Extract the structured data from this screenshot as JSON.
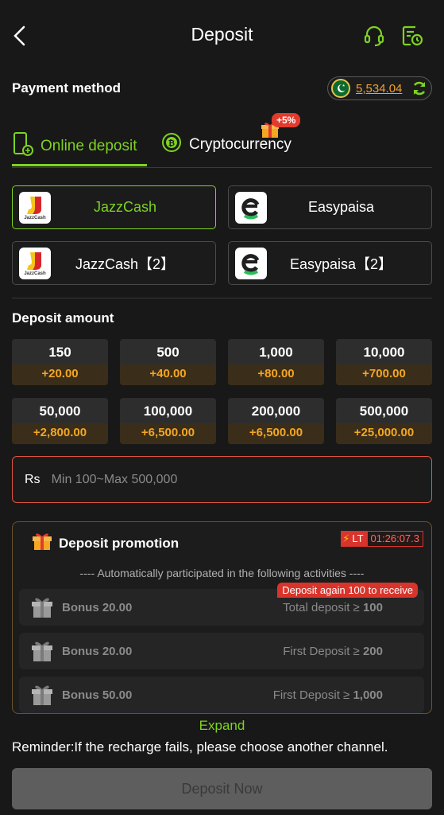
{
  "header": {
    "title": "Deposit"
  },
  "payment_method": {
    "label": "Payment method",
    "balance": "5,534.04"
  },
  "tabs": [
    {
      "label": "Online deposit"
    },
    {
      "label": "Cryptocurrency",
      "badge": "+5%"
    }
  ],
  "channels": [
    {
      "name": "JazzCash",
      "logo_label": "JazzCash"
    },
    {
      "name": "Easypaisa"
    },
    {
      "name": "JazzCash【2】",
      "logo_label": "JazzCash"
    },
    {
      "name": "Easypaisa【2】"
    }
  ],
  "deposit_amount": {
    "label": "Deposit amount",
    "options": [
      {
        "value": "150",
        "bonus": "+20.00"
      },
      {
        "value": "500",
        "bonus": "+40.00"
      },
      {
        "value": "1,000",
        "bonus": "+80.00"
      },
      {
        "value": "10,000",
        "bonus": "+700.00"
      },
      {
        "value": "50,000",
        "bonus": "+2,800.00"
      },
      {
        "value": "100,000",
        "bonus": "+6,500.00"
      },
      {
        "value": "200,000",
        "bonus": "+6,500.00"
      },
      {
        "value": "500,000",
        "bonus": "+25,000.00"
      }
    ]
  },
  "amount_input": {
    "currency": "Rs",
    "placeholder": "Min 100~Max 500,000"
  },
  "promotion": {
    "title": "Deposit promotion",
    "lt_label": "LT",
    "timer": "01:26:07.3",
    "subtitle": "---- Automatically participated in the following activities ----",
    "items": [
      {
        "bonus": "Bonus 20.00",
        "cond_prefix": "Total deposit ≥ ",
        "cond_value": "100",
        "tag": "Deposit again 100 to receive"
      },
      {
        "bonus": "Bonus 20.00",
        "cond_prefix": "First Deposit ≥ ",
        "cond_value": "200"
      },
      {
        "bonus": "Bonus 50.00",
        "cond_prefix": "First Deposit ≥ ",
        "cond_value": "1,000"
      }
    ]
  },
  "expand_label": "Expand",
  "reminder": "Reminder:If the recharge fails, please choose another channel.",
  "deposit_button": "Deposit Now",
  "colors": {
    "accent_green": "#7ed321",
    "bonus_orange": "#f5a623",
    "alert_red": "#d9342b",
    "background": "#181818"
  },
  "icons": [
    "back-arrow-icon",
    "headset-icon",
    "history-icon",
    "pakistan-flag-icon",
    "refresh-icon",
    "phone-deposit-icon",
    "bitcoin-icon",
    "gift-icon",
    "jazzcash-logo-icon",
    "easypaisa-logo-icon",
    "lightning-icon"
  ]
}
